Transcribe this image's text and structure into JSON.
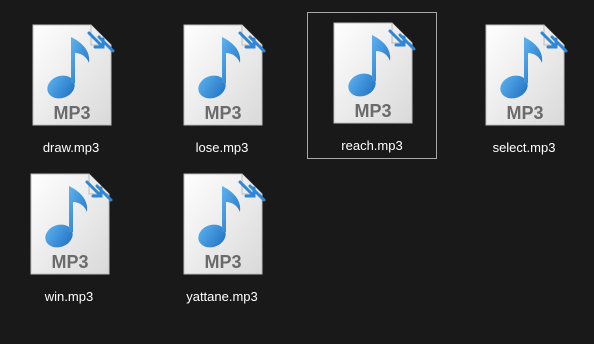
{
  "explorer": {
    "files": [
      {
        "name": "draw.mp3",
        "badge": "MP3",
        "selected": false
      },
      {
        "name": "lose.mp3",
        "badge": "MP3",
        "selected": false
      },
      {
        "name": "reach.mp3",
        "badge": "MP3",
        "selected": true
      },
      {
        "name": "select.mp3",
        "badge": "MP3",
        "selected": false
      },
      {
        "name": "win.mp3",
        "badge": "MP3",
        "selected": false
      },
      {
        "name": "yattane.mp3",
        "badge": "MP3",
        "selected": false
      }
    ]
  },
  "icon": "mp3-audio-file-icon",
  "colors": {
    "background": "#191919",
    "selection_border": "#a8a8a8",
    "note_blue": "#2f86d6",
    "label_text": "#ffffff"
  }
}
